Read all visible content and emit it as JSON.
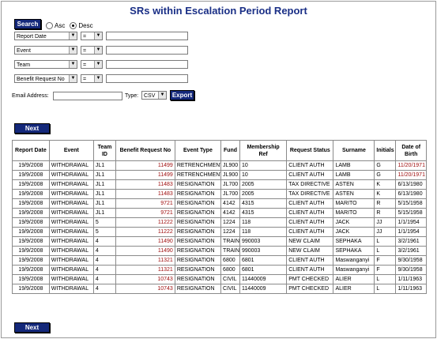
{
  "title": "SRs within Escalation Period Report",
  "search_label": "Search",
  "sort": {
    "asc": "Asc",
    "desc": "Desc",
    "selected": "desc"
  },
  "filters": [
    {
      "field": "Report Date",
      "op": "=",
      "value": ""
    },
    {
      "field": "Event",
      "op": "=",
      "value": ""
    },
    {
      "field": "Team",
      "op": "=",
      "value": ""
    },
    {
      "field": "Benefit Request No",
      "op": "=",
      "value": ""
    }
  ],
  "export": {
    "email_label": "Email Address:",
    "email_value": "",
    "type_label": "Type:",
    "type_value": "CSV",
    "button": "Export"
  },
  "next_label": "Next",
  "table": {
    "headers": [
      "Report Date",
      "Event",
      "Team ID",
      "Benefit Request No",
      "Event Type",
      "Fund",
      "Membership Ref",
      "Request Status",
      "Surname",
      "Initials",
      "Date of Birth"
    ],
    "rows": [
      [
        "19/9/2008",
        "WITHDRAWAL",
        "JL1",
        "11499",
        "RETRENCHMENT",
        "JL900",
        "10",
        "CLIENT AUTH",
        "LAMB",
        "G",
        "11/20/1971"
      ],
      [
        "19/9/2008",
        "WITHDRAWAL",
        "JL1",
        "11499",
        "RETRENCHMENT",
        "JL900",
        "10",
        "CLIENT AUTH",
        "LAMB",
        "G",
        "11/20/1971"
      ],
      [
        "19/9/2008",
        "WITHDRAWAL",
        "JL1",
        "11483",
        "RESIGNATION",
        "JL700",
        "2005",
        "TAX DIRECTIVE",
        "ASTEN",
        "K",
        "6/13/1980"
      ],
      [
        "19/9/2008",
        "WITHDRAWAL",
        "JL1",
        "11483",
        "RESIGNATION",
        "JL700",
        "2005",
        "TAX DIRECTIVE",
        "ASTEN",
        "K",
        "6/13/1980"
      ],
      [
        "19/9/2008",
        "WITHDRAWAL",
        "JL1",
        "9721",
        "RESIGNATION",
        "4142",
        "4315",
        "CLIENT AUTH",
        "MARITO",
        "R",
        "5/15/1958"
      ],
      [
        "19/9/2008",
        "WITHDRAWAL",
        "JL1",
        "9721",
        "RESIGNATION",
        "4142",
        "4315",
        "CLIENT AUTH",
        "MARITO",
        "R",
        "5/15/1958"
      ],
      [
        "19/9/2008",
        "WITHDRAWAL",
        "5",
        "11222",
        "RESIGNATION",
        "1224",
        "118",
        "CLIENT AUTH",
        "JACK",
        "JJ",
        "1/1/1954"
      ],
      [
        "19/9/2008",
        "WITHDRAWAL",
        "5",
        "11222",
        "RESIGNATION",
        "1224",
        "118",
        "CLIENT AUTH",
        "JACK",
        "JJ",
        "1/1/1954"
      ],
      [
        "19/9/2008",
        "WITHDRAWAL",
        "4",
        "11490",
        "RESIGNATION",
        "TRAIN",
        "990003",
        "NEW CLAIM",
        "SEPHAKA",
        "L",
        "3/2/1961"
      ],
      [
        "19/9/2008",
        "WITHDRAWAL",
        "4",
        "11490",
        "RESIGNATION",
        "TRAIN",
        "990003",
        "NEW CLAIM",
        "SEPHAKA",
        "L",
        "3/2/1961"
      ],
      [
        "19/9/2008",
        "WITHDRAWAL",
        "4",
        "11321",
        "RESIGNATION",
        "6800",
        "6801",
        "CLIENT AUTH",
        "Maswanganyi",
        "F",
        "9/30/1958"
      ],
      [
        "19/9/2008",
        "WITHDRAWAL",
        "4",
        "11321",
        "RESIGNATION",
        "6800",
        "6801",
        "CLIENT AUTH",
        "Maswanganyi",
        "F",
        "9/30/1958"
      ],
      [
        "19/9/2008",
        "WITHDRAWAL",
        "4",
        "10743",
        "RESIGNATION",
        "CIVIL",
        "11440009",
        "PMT CHECKED",
        "ALIER",
        "L",
        "1/11/1963"
      ],
      [
        "19/9/2008",
        "WITHDRAWAL",
        "4",
        "10743",
        "RESIGNATION",
        "CIVIL",
        "11440009",
        "PMT CHECKED",
        "ALIER",
        "L",
        "1/11/1963"
      ]
    ]
  },
  "colors": {
    "title": "#1a2f86",
    "button": "#14287a",
    "value_red": "#a01010"
  }
}
